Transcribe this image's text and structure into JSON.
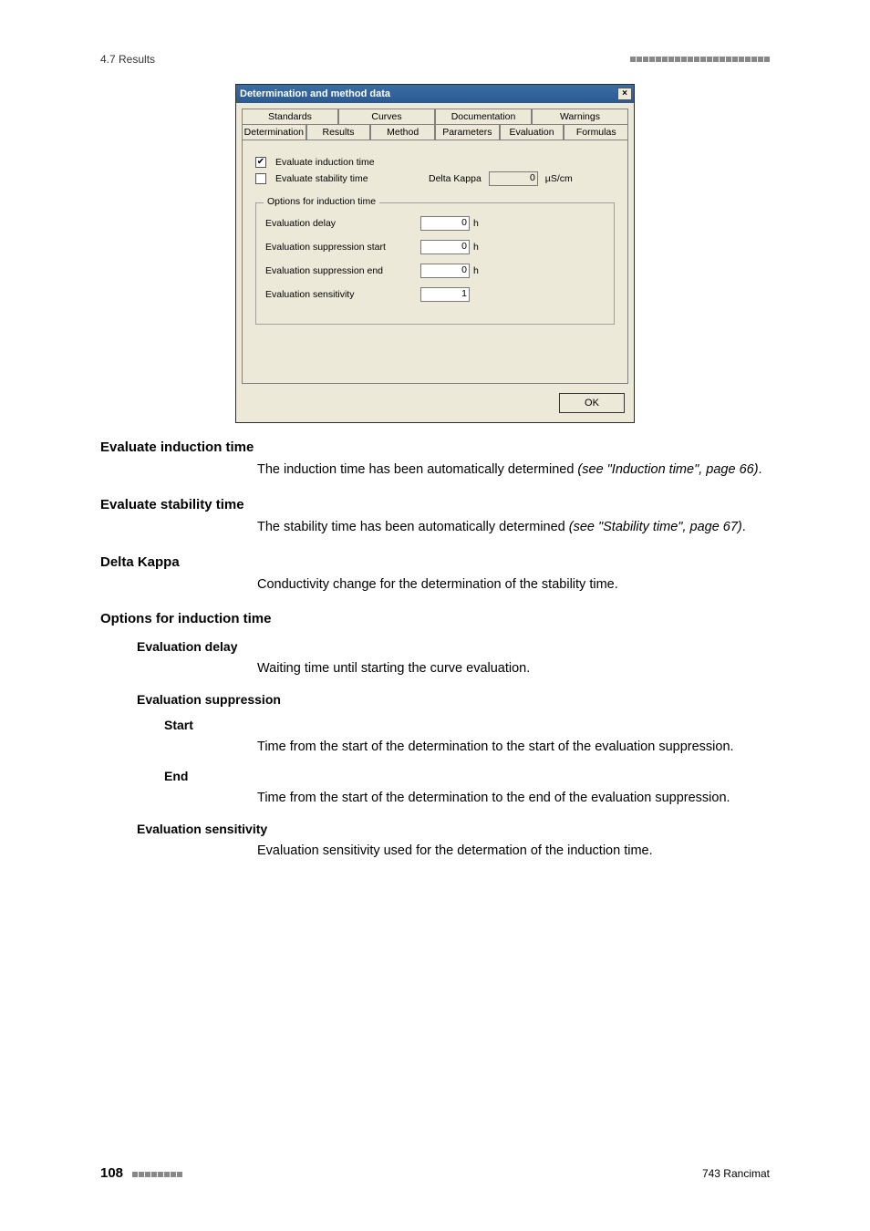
{
  "header": {
    "section": "4.7 Results"
  },
  "dialog": {
    "title": "Determination and method data",
    "close_icon": "×",
    "tabs_row1": [
      "Standards",
      "Curves",
      "Documentation",
      "Warnings"
    ],
    "tabs_row2": [
      "Determination",
      "Results",
      "Method",
      "Parameters",
      "Evaluation",
      "Formulas"
    ],
    "active_tab": "Evaluation",
    "chk1_label": "Evaluate induction time",
    "chk1_checked": "✔",
    "chk2_label": "Evaluate stability time",
    "delta_label": "Delta Kappa",
    "delta_value": "0",
    "delta_unit": "µS/cm",
    "group_legend": "Options for induction time",
    "row_delay_label": "Evaluation delay",
    "row_delay_value": "0",
    "row_delay_unit": "h",
    "row_supp_start_label": "Evaluation suppression start",
    "row_supp_start_value": "0",
    "row_supp_start_unit": "h",
    "row_supp_end_label": "Evaluation suppression end",
    "row_supp_end_value": "0",
    "row_supp_end_unit": "h",
    "row_sens_label": "Evaluation sensitivity",
    "row_sens_value": "1",
    "ok_label": "OK"
  },
  "doc": {
    "h_eval_ind": "Evaluate induction time",
    "p_eval_ind_a": "The induction time has been automatically determined ",
    "p_eval_ind_b": "(see \"Induction time\", page 66)",
    "p_eval_ind_c": ".",
    "h_eval_stab": "Evaluate stability time",
    "p_eval_stab_a": "The stability time has been automatically determined ",
    "p_eval_stab_b": "(see \"Stability time\", page 67)",
    "p_eval_stab_c": ".",
    "h_delta": "Delta Kappa",
    "p_delta": "Conductivity change for the determination of the stability time.",
    "h_options": "Options for induction time",
    "h4_eval_delay": "Evaluation delay",
    "p_eval_delay": "Waiting time until starting the curve evaluation.",
    "h4_eval_supp": "Evaluation suppression",
    "h5_start": "Start",
    "p_start": "Time from the start of the determination to the start of the evaluation suppression.",
    "h5_end": "End",
    "p_end": "Time from the start of the determination to the end of the evaluation suppression.",
    "h4_eval_sens": "Evaluation sensitivity",
    "p_eval_sens": "Evaluation sensitivity used for the determation of the induction time."
  },
  "footer": {
    "page_number": "108",
    "doc_name": "743 Rancimat"
  }
}
